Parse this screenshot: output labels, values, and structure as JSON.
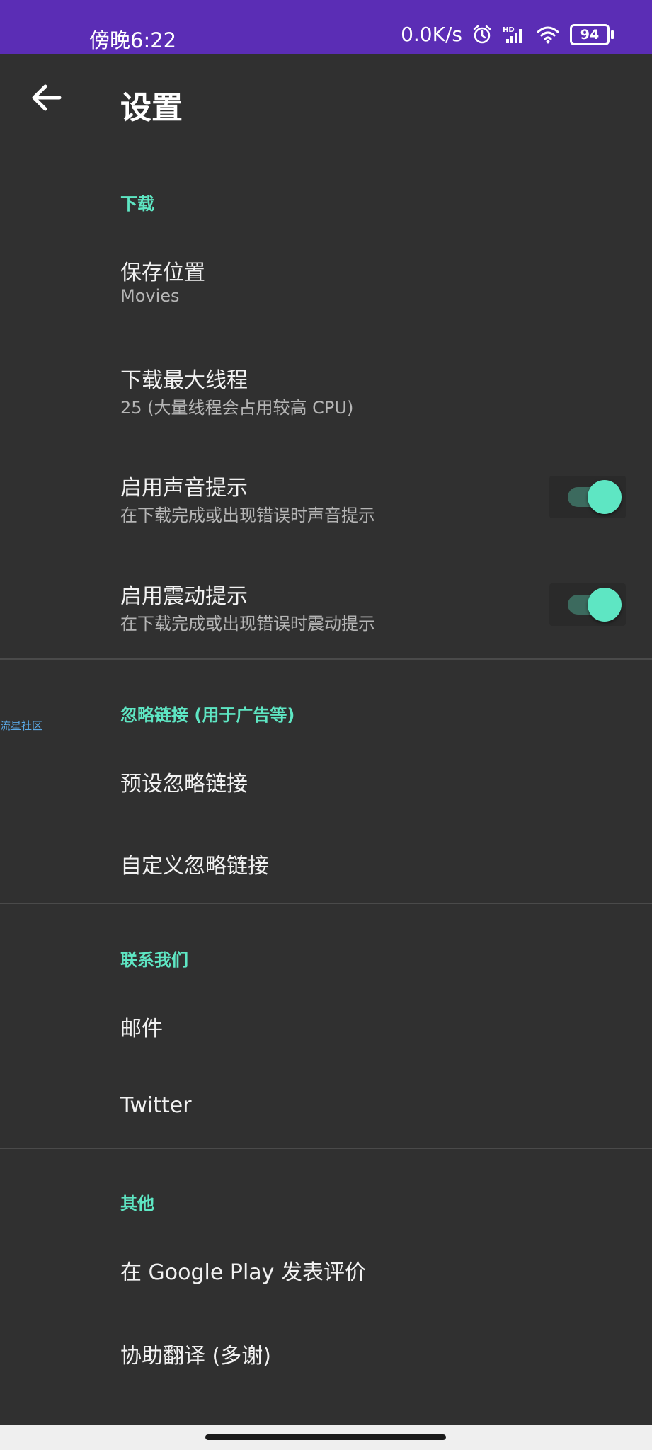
{
  "status_bar": {
    "time": "傍晚6:22",
    "net_speed": "0.0K/s",
    "battery": "94",
    "icons": [
      "alarm-icon",
      "hd-signal-icon",
      "wifi-icon",
      "battery-icon"
    ]
  },
  "toolbar": {
    "title": "设置",
    "back_icon": "arrow-left-icon"
  },
  "sections": {
    "download": {
      "header": "下载",
      "save_location": {
        "title": "保存位置",
        "subtitle": "Movies"
      },
      "max_threads": {
        "title": "下载最大线程",
        "subtitle": "25 (大量线程会占用较高 CPU)"
      },
      "sound": {
        "title": "启用声音提示",
        "subtitle": "在下载完成或出现错误时声音提示",
        "enabled": true
      },
      "vibrate": {
        "title": "启用震动提示",
        "subtitle": "在下载完成或出现错误时震动提示",
        "enabled": true
      }
    },
    "ignore": {
      "header": "忽略链接 (用于广告等)",
      "preset": "预设忽略链接",
      "custom": "自定义忽略链接"
    },
    "contact": {
      "header": "联系我们",
      "email": "邮件",
      "twitter": "Twitter"
    },
    "other": {
      "header": "其他",
      "rate": "在 Google Play 发表评价",
      "translate": "协助翻译 (多谢)"
    }
  },
  "watermark": "流星社区",
  "colors": {
    "status_bar": "#5b2db5",
    "background": "#303030",
    "accent": "#5ee6c3",
    "divider": "#4a4a4a"
  }
}
